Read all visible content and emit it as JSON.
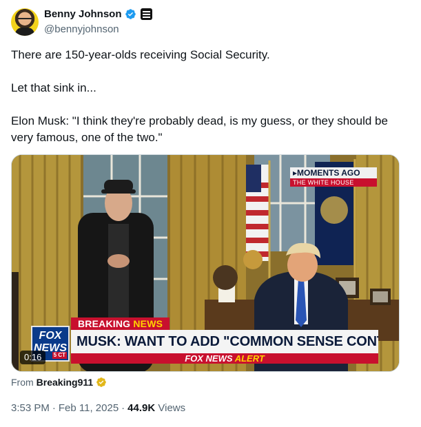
{
  "author": {
    "display_name": "Benny Johnson",
    "handle": "@bennyjohnson",
    "verified_color": "#1d9bf0"
  },
  "tweet": {
    "paragraphs": [
      "There are 150-year-olds receiving Social Security.",
      "Let that sink in...",
      "Elon Musk: \"I think they're probably dead, is my guess, or they should be very famous, one of the two.\""
    ]
  },
  "video": {
    "duration": "0:16",
    "overlay": {
      "breaking_prefix": "BREAKING",
      "breaking_accent": "NEWS",
      "headline": "MUSK: WANT TO ADD \"COMMON SENSE CONTROLS\"",
      "alert_prefix": "FOX NEWS",
      "alert_accent": "ALERT",
      "moments_top": "MOMENTS AGO",
      "moments_bottom": "THE WHITE HOUSE",
      "logo_line1": "FOX",
      "logo_line2": "NEWS",
      "logo_tag": "5 CT"
    }
  },
  "attribution": {
    "prefix": "From",
    "source": "Breaking911",
    "badge_color": "#e2b719"
  },
  "meta": {
    "time": "3:53 PM",
    "date": "Feb 11, 2025",
    "views_count": "44.9K",
    "views_label": "Views"
  }
}
